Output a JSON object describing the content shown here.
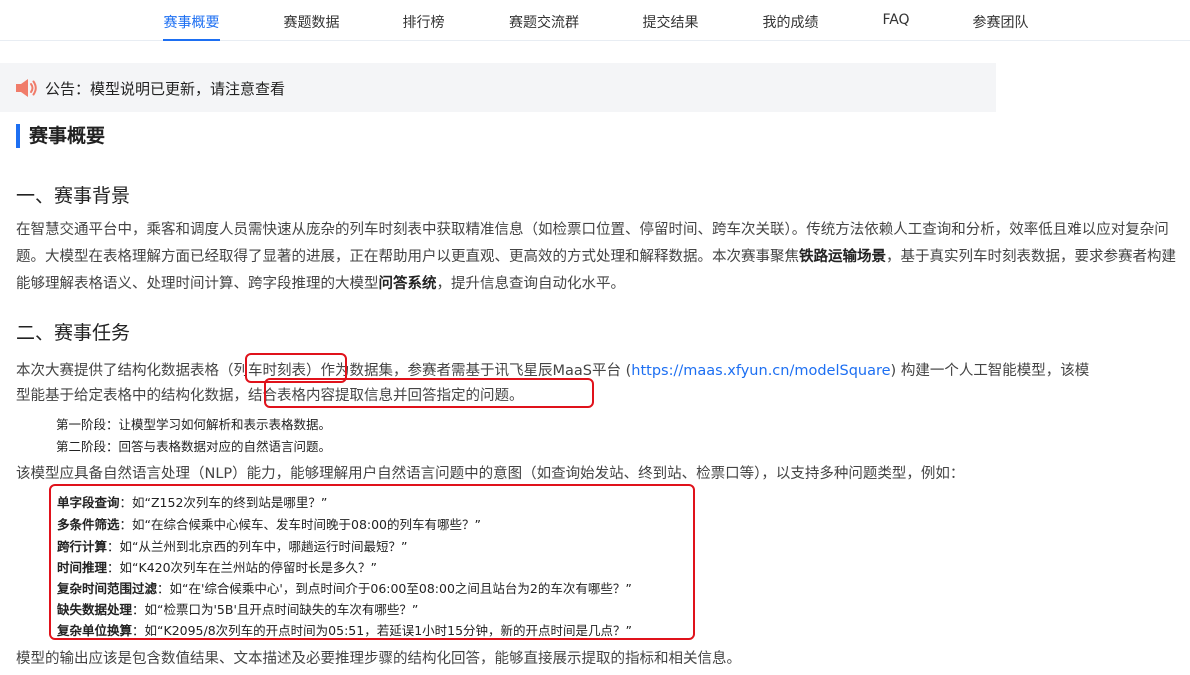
{
  "nav": {
    "tabs": [
      "赛事概要",
      "赛题数据",
      "排行榜",
      "赛题交流群",
      "提交结果",
      "我的成绩",
      "FAQ",
      "参赛团队"
    ],
    "active_index": 0
  },
  "notice": {
    "text": "公告：模型说明已更新，请注意查看"
  },
  "page_title": "赛事概要",
  "section1": {
    "heading": "一、赛事背景",
    "text_a": "在智慧交通平台中，乘客和调度人员需快速从庞杂的列车时刻表中获取精准信息（如检票口位置、停留时间、跨车次关联）。传统方法依赖人工查询和分析，效率低且难以应对复杂问题。大模型在表格理解方面已经取得了显著的进展，正在帮助用户以更直观、更高效的方式处理和解释数据。本次赛事聚焦",
    "bold_a": "铁路运输场景",
    "text_b": "，基于真实列车时刻表数据，要求参赛者构建能够理解表格语义、处理时间计算、跨字段推理的大模型",
    "bold_b": "问答系统",
    "text_c": "，提升信息查询自动化水平。"
  },
  "section2": {
    "heading": "二、赛事任务",
    "line1_pre": "本次大赛提供了结构化数据表格",
    "line1_box": "（列车时刻表）",
    "line1_mid": "作为数据集，参赛者需基于讯飞星辰MaaS平台 (",
    "link": "https://maas.xfyun.cn/modelSquare",
    "line1_post": ") 构建一个人工智能模型，该模",
    "line2_pre": "型能基于给定表格中的结构化数据，",
    "line2_box": "结合表格内容提取信息并回答指定的问题。",
    "stage1": "第一阶段：让模型学习如何解析和表示表格数据。",
    "stage2": "第二阶段：回答与表格数据对应的自然语言问题。",
    "capability": "该模型应具备自然语言处理（NLP）能力，能够理解用户自然语言问题中的意图（如查询始发站、终到站、检票口等），以支持多种问题类型，例如：",
    "examples": [
      {
        "label": "单字段查询",
        "text": "：如“Z152次列车的终到站是哪里？”"
      },
      {
        "label": "多条件筛选",
        "text": "：如“在综合候乘中心候车、发车时间晚于08:00的列车有哪些？”"
      },
      {
        "label": "跨行计算",
        "text": "：如“从兰州到北京西的列车中，哪趟运行时间最短？”"
      },
      {
        "label": "时间推理",
        "text": "：如“K420次列车在兰州站的停留时长是多久？”"
      },
      {
        "label": "复杂时间范围过滤",
        "text": "：如“在'综合候乘中心'，到点时间介于06:00至08:00之间且站台为2的车次有哪些？”"
      },
      {
        "label": "缺失数据处理",
        "text": "：如“检票口为'5B'且开点时间缺失的车次有哪些？”"
      },
      {
        "label": "复杂单位换算",
        "text": "：如“K2095/8次列车的开点时间为05:51，若延误1小时15分钟，新的开点时间是几点？”"
      }
    ],
    "output_note": "模型的输出应该是包含数值结果、文本描述及必要推理步骤的结构化回答，能够直接展示提取的指标和相关信息。"
  },
  "colors": {
    "accent": "#1d6ff2",
    "highlight_box": "#e0121b",
    "notice_bg": "#f4f5f7",
    "speaker": "#f07c6a"
  },
  "icons": {
    "notice": "speaker-icon"
  }
}
